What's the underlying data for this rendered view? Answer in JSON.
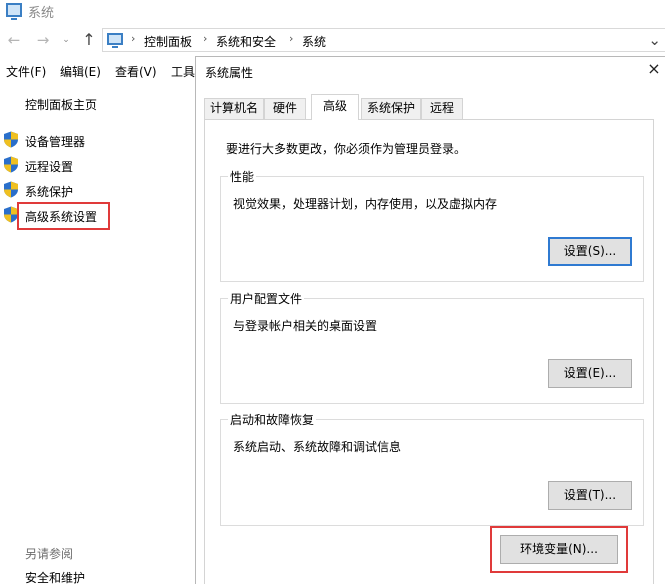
{
  "window": {
    "title": "系统"
  },
  "nav": {
    "back": "←",
    "forward": "→",
    "dropdown": "⌄",
    "up": "↑",
    "breadcrumbs": [
      "控制面板",
      "系统和安全",
      "系统"
    ],
    "separator": "›",
    "address_more": "⌄"
  },
  "menu": {
    "items": [
      "文件(F)",
      "编辑(E)",
      "查看(V)",
      "工具"
    ]
  },
  "sidebar": {
    "home": "控制面板主页",
    "links": [
      "设备管理器",
      "远程设置",
      "系统保护",
      "高级系统设置"
    ],
    "see_also_heading": "另请参阅",
    "see_also_link": "安全和维护"
  },
  "dialog": {
    "title": "系统属性",
    "close": "×",
    "tabs": [
      "计算机名",
      "硬件",
      "高级",
      "系统保护",
      "远程"
    ],
    "active_tab": "高级",
    "admin_note": "要进行大多数更改，你必须作为管理员登录。",
    "groups": [
      {
        "title": "性能",
        "description": "视觉效果，处理器计划，内存使用，以及虚拟内存",
        "button": "设置(S)..."
      },
      {
        "title": "用户配置文件",
        "description": "与登录帐户相关的桌面设置",
        "button": "设置(E)..."
      },
      {
        "title": "启动和故障恢复",
        "description": "系统启动、系统故障和调试信息",
        "button": "设置(T)..."
      }
    ],
    "env_button": "环境变量(N)..."
  },
  "colors": {
    "highlight": "#e03a3a",
    "focus": "#2f7ad1",
    "shield_blue": "#2a6fcb",
    "shield_yellow": "#f0c020"
  },
  "icons": {
    "title": "computer-icon",
    "address": "computer-icon",
    "shield": "uac-shield-icon",
    "close": "close-icon"
  }
}
